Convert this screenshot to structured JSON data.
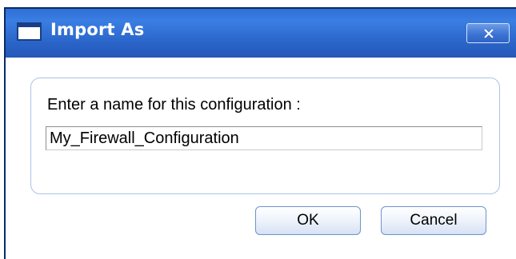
{
  "window": {
    "title": "Import As",
    "title_icon": "window-icon",
    "close_icon": "close-icon",
    "colors": {
      "titlebar": "#2f6fd6",
      "frame": "#0b2a63",
      "group_border": "#a9c3e8",
      "button_border": "#6f93c8"
    }
  },
  "form": {
    "prompt": "Enter a name for this configuration :",
    "name_value": "My_Firewall_Configuration"
  },
  "buttons": {
    "ok": "OK",
    "cancel": "Cancel"
  }
}
